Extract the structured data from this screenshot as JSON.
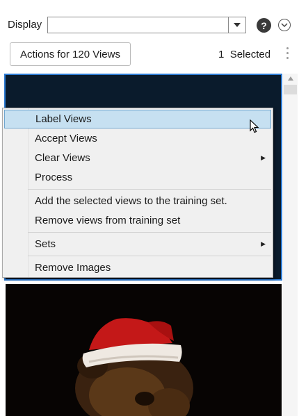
{
  "toolbar": {
    "display_label": "Display",
    "display_value": "",
    "actions_button": "Actions for 120 Views",
    "selected_count": "1",
    "selected_label": "Selected"
  },
  "context_menu": {
    "items": [
      {
        "label": "Label Views",
        "highlighted": true,
        "submenu": false
      },
      {
        "label": "Accept Views",
        "submenu": false
      },
      {
        "label": "Clear Views",
        "submenu": true
      },
      {
        "label": "Process",
        "submenu": false
      },
      {
        "label": "Add the selected views to the training set.",
        "submenu": false
      },
      {
        "label": "Remove views from training set",
        "submenu": false
      },
      {
        "label": "Sets",
        "submenu": true
      },
      {
        "label": "Remove Images",
        "submenu": false
      }
    ]
  },
  "icons": {
    "help": "help-icon",
    "expand": "chevron-down-circle-icon",
    "more": "more-vertical-icon",
    "dropdown": "chevron-down-icon",
    "submenu": "chevron-right-icon"
  },
  "colors": {
    "selection_border": "#2d7bd3",
    "menu_highlight": "#c6e0f1",
    "menu_background": "#f0f0f0"
  }
}
